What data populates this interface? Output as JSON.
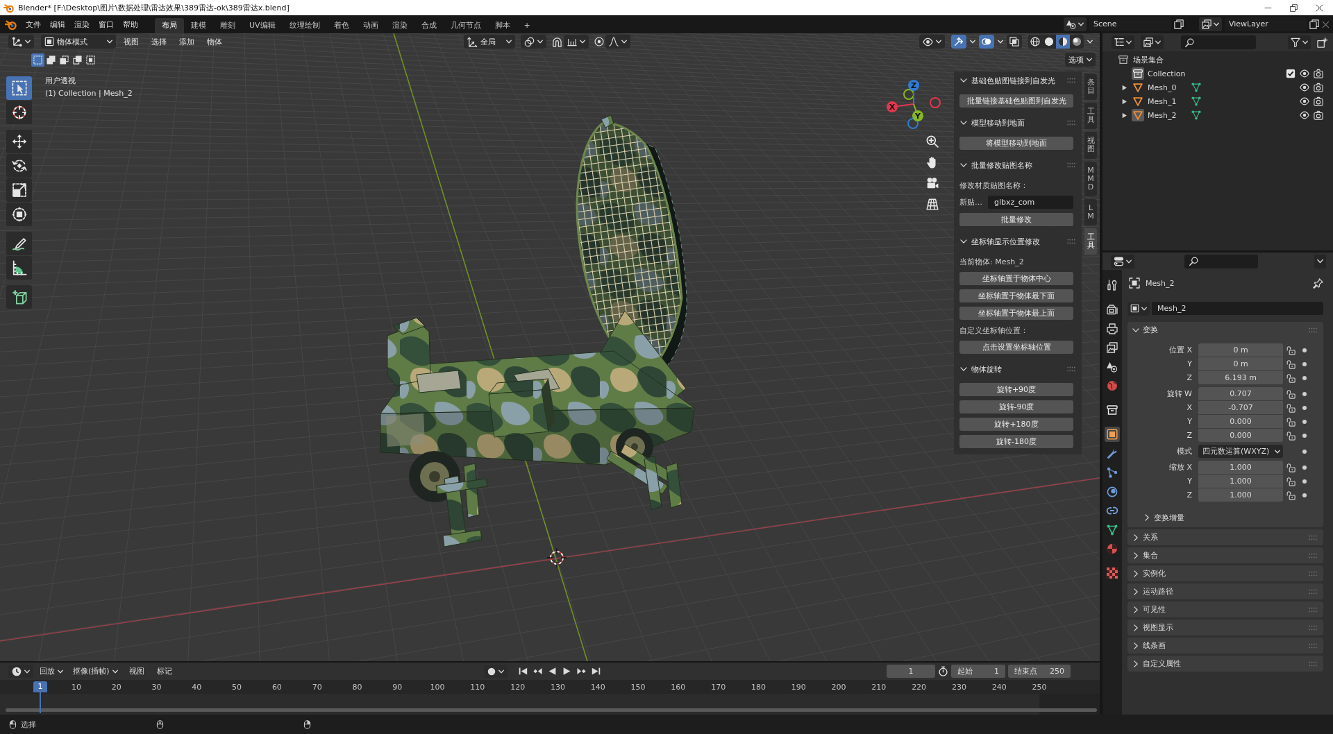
{
  "window": {
    "title": "Blender* [F:\\Desktop\\图片\\数据处理\\雷达效果\\389雷达-ok\\389雷达x.blend]"
  },
  "top_bar": {
    "menus": [
      "文件",
      "编辑",
      "渲染",
      "窗口",
      "帮助"
    ],
    "workspaces": [
      {
        "label": "布局",
        "selected": true
      },
      {
        "label": "建模",
        "selected": false
      },
      {
        "label": "雕刻",
        "selected": false
      },
      {
        "label": "UV编辑",
        "selected": false
      },
      {
        "label": "纹理绘制",
        "selected": false
      },
      {
        "label": "着色",
        "selected": false
      },
      {
        "label": "动画",
        "selected": false
      },
      {
        "label": "渲染",
        "selected": false
      },
      {
        "label": "合成",
        "selected": false
      },
      {
        "label": "几何节点",
        "selected": false
      },
      {
        "label": "脚本",
        "selected": false
      }
    ],
    "add_workspace": "+",
    "scene": "Scene",
    "view_layer": "ViewLayer"
  },
  "viewport": {
    "mode": "物体模式",
    "menus": [
      "视图",
      "选择",
      "添加",
      "物体"
    ],
    "orientation": "全局",
    "toggles": [
      {
        "kind": "gizmos",
        "on": true
      },
      {
        "kind": "overlays",
        "on": true
      },
      {
        "kind": "xray",
        "on": false
      }
    ],
    "shading": [
      {
        "kind": "wireframe",
        "selected": false
      },
      {
        "kind": "solid",
        "selected": false
      },
      {
        "kind": "material",
        "selected": true
      },
      {
        "kind": "rendered",
        "selected": false
      }
    ],
    "select_modes": [
      {
        "kind": "set",
        "selected": true
      },
      {
        "kind": "extend",
        "selected": false
      },
      {
        "kind": "subtract",
        "selected": false
      },
      {
        "kind": "invert",
        "selected": false
      },
      {
        "kind": "intersect",
        "selected": false
      }
    ],
    "options": "选项",
    "view_name": "用户透视",
    "object_info": "(1) Collection | Mesh_2",
    "tool_groups": [
      {
        "tools": [
          {
            "kind": "select",
            "selected": true
          },
          {
            "kind": "cursor",
            "selected": false
          }
        ]
      },
      {
        "tools": [
          {
            "kind": "move",
            "selected": false
          },
          {
            "kind": "rotate",
            "selected": false
          },
          {
            "kind": "scale",
            "selected": false
          },
          {
            "kind": "transform",
            "selected": false
          }
        ]
      },
      {
        "tools": [
          {
            "kind": "annotate",
            "selected": false
          },
          {
            "kind": "measure",
            "selected": false
          }
        ]
      },
      {
        "tools": [
          {
            "kind": "add_cube",
            "selected": false
          }
        ]
      }
    ],
    "gizmo_axes": [
      {
        "label": "Z",
        "color": "#2f7cd3"
      },
      {
        "label": "X",
        "color": "#e4364e"
      },
      {
        "label": "Y",
        "color": "#86b823"
      }
    ]
  },
  "sidebar": {
    "panels": [
      {
        "title": "基础色贴图链接到自发光",
        "expanded": true,
        "items": [
          {
            "kind": "button",
            "label": "批量链接基础色贴图到自发光"
          }
        ]
      },
      {
        "title": "模型移动到地面",
        "expanded": true,
        "items": [
          {
            "kind": "button",
            "label": "将模型移动到地面"
          }
        ]
      },
      {
        "title": "批量修改贴图名称",
        "expanded": true,
        "items": [
          {
            "kind": "label",
            "label": "修改材质贴图名称："
          },
          {
            "kind": "field",
            "label": "新贴…",
            "value": "glbxz_com"
          },
          {
            "kind": "button",
            "label": "批量修改"
          }
        ]
      },
      {
        "title": "坐标轴显示位置修改",
        "expanded": true,
        "items": [
          {
            "kind": "label",
            "label": "当前物体: Mesh_2"
          },
          {
            "kind": "button",
            "label": "坐标轴置于物体中心"
          },
          {
            "kind": "button",
            "label": "坐标轴置于物体最下面"
          },
          {
            "kind": "button",
            "label": "坐标轴置于物体最上面"
          },
          {
            "kind": "label",
            "label": "自定义坐标轴位置："
          },
          {
            "kind": "button",
            "label": "点击设置坐标轴位置"
          }
        ]
      },
      {
        "title": "物体旋转",
        "expanded": true,
        "items": [
          {
            "kind": "button",
            "label": "旋转+90度"
          },
          {
            "kind": "button",
            "label": "旋转-90度"
          },
          {
            "kind": "button",
            "label": "旋转+180度"
          },
          {
            "kind": "button",
            "label": "旋转-180度"
          }
        ]
      }
    ],
    "tabs": [
      {
        "label": "条目",
        "selected": false
      },
      {
        "label": "工具",
        "selected": false
      },
      {
        "label": "视图",
        "selected": false
      },
      {
        "label": "MMD",
        "selected": false
      },
      {
        "label": "LM",
        "selected": false
      },
      {
        "label": "工具",
        "selected": true
      }
    ]
  },
  "outliner": {
    "tree": [
      {
        "kind": "scene_collection",
        "label": "场景集合",
        "children": [
          {
            "kind": "collection",
            "label": "Collection",
            "active": true,
            "checked": true,
            "children": [
              {
                "kind": "mesh",
                "label": "Mesh_0",
                "expanded": false,
                "active": false
              },
              {
                "kind": "mesh",
                "label": "Mesh_1",
                "expanded": false,
                "active": false
              },
              {
                "kind": "mesh",
                "label": "Mesh_2",
                "expanded": false,
                "active": true
              }
            ]
          }
        ]
      }
    ]
  },
  "properties": {
    "tab_groups": [
      {
        "tabs": [
          {
            "kind": "tool",
            "selected": false
          }
        ]
      },
      {
        "tabs": [
          {
            "kind": "render",
            "selected": false
          },
          {
            "kind": "output",
            "selected": false
          },
          {
            "kind": "view_layer",
            "selected": false
          },
          {
            "kind": "scene",
            "selected": false
          },
          {
            "kind": "world",
            "selected": false
          }
        ]
      },
      {
        "tabs": [
          {
            "kind": "collection",
            "selected": false
          }
        ]
      },
      {
        "tabs": [
          {
            "kind": "object",
            "selected": true
          },
          {
            "kind": "modifiers",
            "selected": false
          },
          {
            "kind": "particles",
            "selected": false
          },
          {
            "kind": "physics",
            "selected": false
          },
          {
            "kind": "constraints",
            "selected": false
          },
          {
            "kind": "data",
            "selected": false
          },
          {
            "kind": "material",
            "selected": false
          }
        ]
      },
      {
        "tabs": [
          {
            "kind": "texture",
            "selected": false
          }
        ]
      }
    ],
    "object_name": "Mesh_2",
    "data_name": "Mesh_2",
    "panels": [
      {
        "title": "变换",
        "expanded": true,
        "groups": [
          {
            "rows": [
              {
                "kind": "number",
                "label": "位置 X",
                "value": "0 m",
                "locked": false
              },
              {
                "kind": "number",
                "label": "Y",
                "value": "0 m",
                "locked": false
              },
              {
                "kind": "number",
                "label": "Z",
                "value": "6.193 m",
                "locked": false
              }
            ]
          },
          {
            "rows": [
              {
                "kind": "number",
                "label": "旋转 W",
                "value": "0.707",
                "locked": false
              },
              {
                "kind": "number",
                "label": "X",
                "value": "-0.707",
                "locked": false
              },
              {
                "kind": "number",
                "label": "Y",
                "value": "0.000",
                "locked": false
              },
              {
                "kind": "number",
                "label": "Z",
                "value": "0.000",
                "locked": false
              }
            ]
          },
          {
            "rows": [
              {
                "kind": "dropdown",
                "label": "模式",
                "value": "四元数运算(WXYZ)"
              }
            ]
          },
          {
            "rows": [
              {
                "kind": "number",
                "label": "缩放 X",
                "value": "1.000",
                "locked": false
              },
              {
                "kind": "number",
                "label": "Y",
                "value": "1.000",
                "locked": false
              },
              {
                "kind": "number",
                "label": "Z",
                "value": "1.000",
                "locked": false
              }
            ]
          }
        ],
        "subpanels": [
          {
            "title": "变换增量",
            "expanded": false
          }
        ]
      },
      {
        "title": "关系",
        "expanded": false
      },
      {
        "title": "集合",
        "expanded": false
      },
      {
        "title": "实例化",
        "expanded": false
      },
      {
        "title": "运动路径",
        "expanded": false
      },
      {
        "title": "可见性",
        "expanded": false
      },
      {
        "title": "视图显示",
        "expanded": false
      },
      {
        "title": "线条画",
        "expanded": false
      },
      {
        "title": "自定义属性",
        "expanded": false
      }
    ]
  },
  "timeline": {
    "menus": [
      {
        "kind": "popover",
        "label": "回放"
      },
      {
        "kind": "popover",
        "label": "抠像(插帧)"
      },
      {
        "kind": "menu",
        "label": "视图"
      },
      {
        "kind": "menu",
        "label": "标记"
      }
    ],
    "current_frame": "1",
    "start_label": "起始",
    "start": "1",
    "end_label": "结束点",
    "end": "250",
    "playhead": "1",
    "ruler": [
      "10",
      "20",
      "30",
      "40",
      "50",
      "60",
      "70",
      "80",
      "90",
      "100",
      "110",
      "120",
      "130",
      "140",
      "150",
      "160",
      "170",
      "180",
      "190",
      "200",
      "210",
      "220",
      "230",
      "240",
      "250"
    ]
  },
  "status_bar": {
    "hints": [
      {
        "kind": "mouse_left",
        "label": "选择"
      },
      {
        "kind": "mouse_middle"
      },
      {
        "kind": "mouse_right"
      }
    ]
  }
}
